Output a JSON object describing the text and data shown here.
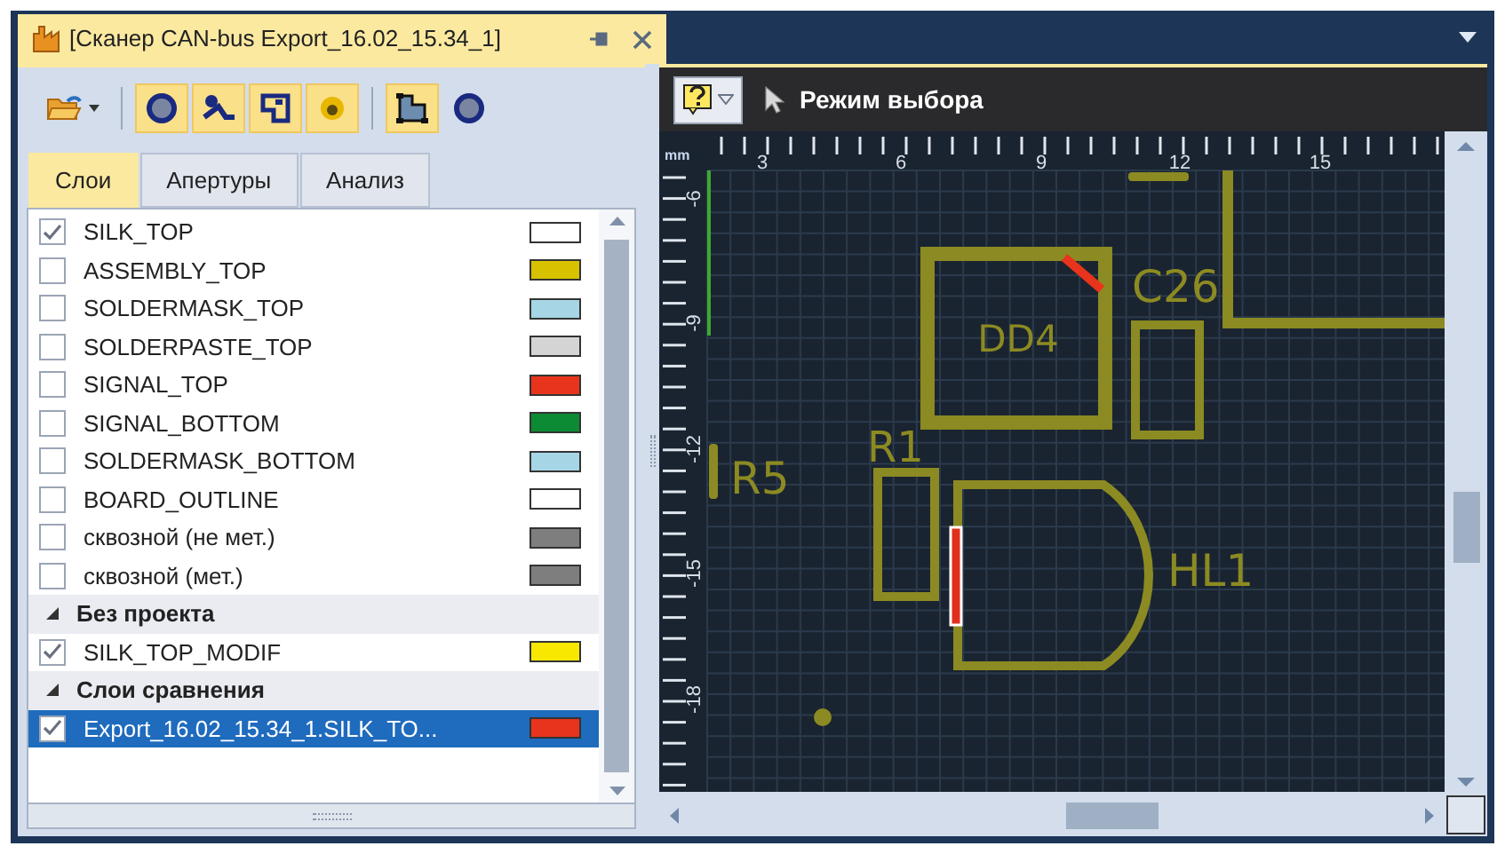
{
  "document_tab": {
    "title": "[Сканер CAN-bus Export_16.02_15.34_1]"
  },
  "tool_buttons": [
    {
      "on": false
    },
    {
      "on": true
    },
    {
      "on": true
    },
    {
      "on": true
    },
    {
      "on": true
    },
    {
      "on": true
    },
    {
      "on": false
    }
  ],
  "panel_tabs": [
    {
      "label": "Слои",
      "selected": true
    },
    {
      "label": "Апертуры",
      "selected": false
    },
    {
      "label": "Анализ",
      "selected": false
    }
  ],
  "layer_groups": [
    {
      "items": [
        {
          "name": "SILK_TOP",
          "checked": true,
          "color": "#ffffff",
          "selected": false
        },
        {
          "name": "ASSEMBLY_TOP",
          "checked": false,
          "color": "#d8c200",
          "selected": false
        },
        {
          "name": "SOLDERMASK_TOP",
          "checked": false,
          "color": "#a6d6e6",
          "selected": false
        },
        {
          "name": "SOLDERPASTE_TOP",
          "checked": false,
          "color": "#d4d4d4",
          "selected": false
        },
        {
          "name": "SIGNAL_TOP",
          "checked": false,
          "color": "#e8341c",
          "selected": false
        },
        {
          "name": "SIGNAL_BOTTOM",
          "checked": false,
          "color": "#0c8a34",
          "selected": false
        },
        {
          "name": "SOLDERMASK_BOTTOM",
          "checked": false,
          "color": "#a6d6e6",
          "selected": false
        },
        {
          "name": "BOARD_OUTLINE",
          "checked": false,
          "color": "#ffffff",
          "selected": false
        },
        {
          "name": "сквозной (не мет.)",
          "checked": false,
          "color": "#7e7e7e",
          "selected": false
        },
        {
          "name": "сквозной (мет.)",
          "checked": false,
          "color": "#7e7e7e",
          "selected": false
        }
      ]
    },
    {
      "title": "Без проекта",
      "expanded": true,
      "items": [
        {
          "name": "SILK_TOP_MODIF",
          "checked": true,
          "color": "#f8e800",
          "selected": false
        }
      ]
    },
    {
      "title": "Слои сравнения",
      "expanded": true,
      "items": [
        {
          "name": "Export_16.02_15.34_1.SILK_TO...",
          "checked": true,
          "color": "#e8341c",
          "selected": true
        }
      ]
    }
  ],
  "view_toolbar": {
    "mode": "Режим выбора"
  },
  "ruler": {
    "unit": "mm",
    "x_labels": [
      "3",
      "6",
      "9",
      "12",
      "15"
    ],
    "y_labels": [
      "-6",
      "-9",
      "-12",
      "-15",
      "-18"
    ]
  },
  "board": {
    "labels": [
      "DD4",
      "C26",
      "R5",
      "R1",
      "HL1"
    ]
  }
}
